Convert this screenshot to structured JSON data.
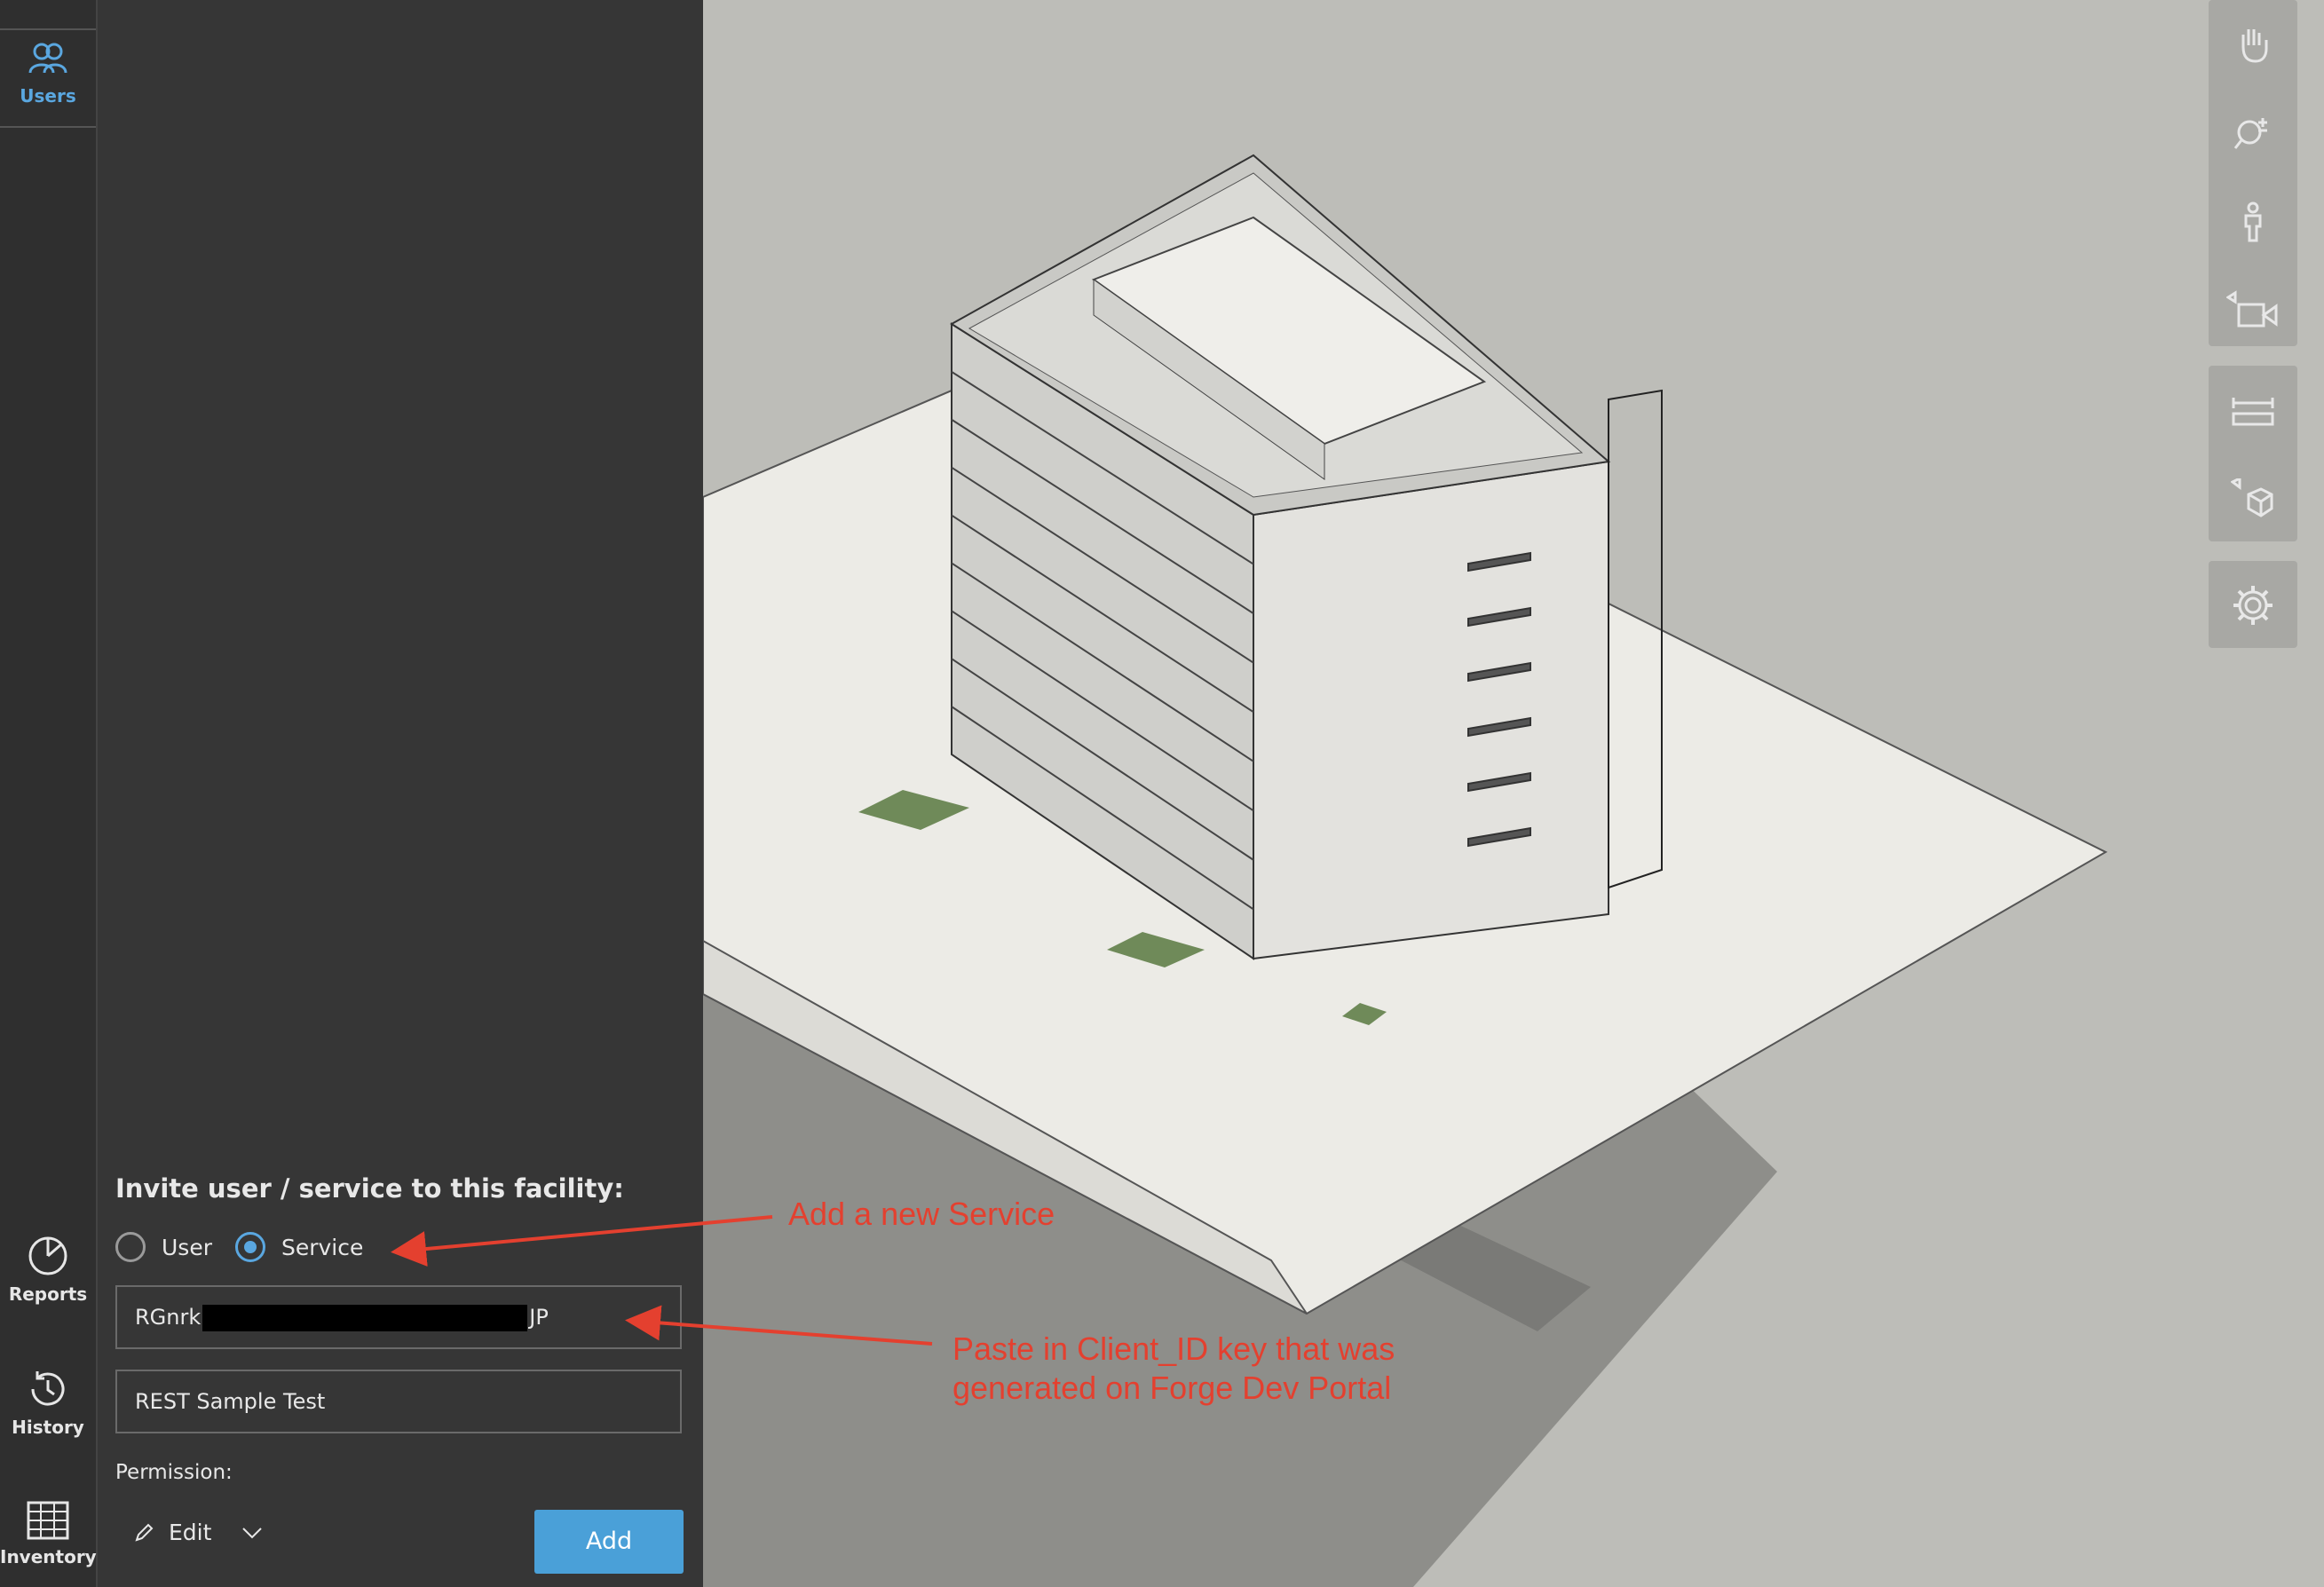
{
  "rail": {
    "users": {
      "label": "Users",
      "icon": "users-icon"
    },
    "reports": {
      "label": "Reports",
      "icon": "reports-icon"
    },
    "history": {
      "label": "History",
      "icon": "history-icon"
    },
    "inventory": {
      "label": "Inventory",
      "icon": "inventory-icon"
    }
  },
  "invite": {
    "title": "Invite user / service to this facility:",
    "options": [
      {
        "label": "User",
        "checked": false
      },
      {
        "label": "Service",
        "checked": true
      }
    ],
    "client_id_prefix": "RGnrk",
    "client_id_suffix": "JP",
    "name_value": "REST Sample Test",
    "permission_label": "Permission:",
    "permission_value": "Edit",
    "add_label": "Add"
  },
  "toolbar": {
    "group1": [
      "pan-icon",
      "zoom-icon",
      "walk-icon",
      "camera-icon"
    ],
    "group2": [
      "measure-icon",
      "section-icon"
    ],
    "group3": [
      "settings-icon"
    ]
  },
  "annotations": {
    "service_note": "Add a new Service",
    "client_note_line1": "Paste in Client_ID key that was",
    "client_note_line2": "generated on Forge Dev Portal"
  },
  "colors": {
    "accent": "#4aa0d8",
    "annotation": "#e4402f",
    "panel": "#363636",
    "rail": "#2f2f2f"
  }
}
